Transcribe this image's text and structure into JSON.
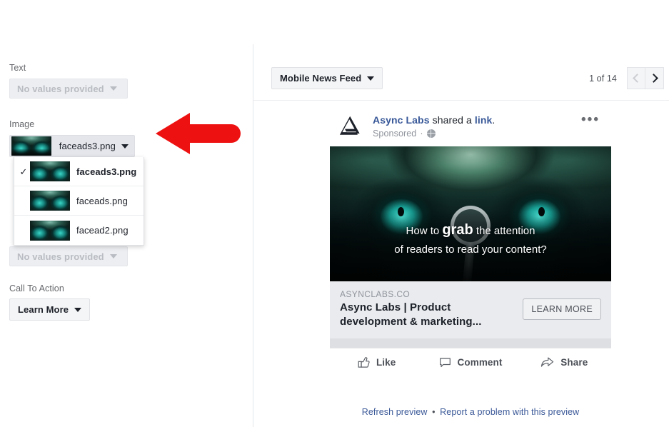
{
  "left_panel": {
    "text_field": {
      "label": "Text",
      "value": "No values provided"
    },
    "image_field": {
      "label": "Image",
      "selected_value": "faceads3.png",
      "options": [
        {
          "name": "faceads3.png",
          "checked": true
        },
        {
          "name": "faceads.png",
          "checked": false
        },
        {
          "name": "facead2.png",
          "checked": false
        }
      ]
    },
    "hidden_field": {
      "value": "No values provided"
    },
    "cta_field": {
      "label": "Call To Action",
      "value": "Learn More"
    },
    "annotation": {
      "shape": "left-pointing-arrow",
      "color": "#ee1111"
    }
  },
  "preview": {
    "toolbar": {
      "placement_label": "Mobile News Feed",
      "pager_count": "1 of 14",
      "prev_label": "Previous preview",
      "next_label": "Next preview",
      "prev_disabled": true
    },
    "ad": {
      "page_name": "Async Labs",
      "shared_text": "shared a",
      "link_word": "link",
      "period": ".",
      "sponsored": "Sponsored",
      "separator": "·",
      "privacy_icon": "globe-icon",
      "menu_icon": "ellipsis-icon",
      "creative": {
        "line1_prefix": "How to ",
        "line1_bold": "grab",
        "line1_suffix": " the attention",
        "line2": "of readers to read your content?",
        "alt": "Teal eyes formed from forest imagery with a magnifying glass"
      },
      "link_card": {
        "domain": "ASYNCLABS.CO",
        "title": "Async Labs | Product development & marketing...",
        "cta_button": "LEARN MORE"
      },
      "actions": [
        {
          "icon": "thumbs-up-icon",
          "label": "Like"
        },
        {
          "icon": "comment-bubble-icon",
          "label": "Comment"
        },
        {
          "icon": "share-arrow-icon",
          "label": "Share"
        }
      ]
    },
    "footer_links": {
      "refresh": "Refresh preview",
      "separator": "•",
      "report": "Report a problem with this preview"
    }
  },
  "colors": {
    "link_blue": "#385898",
    "annotation_red": "#ee1111",
    "card_meta_bg": "#e9ebee",
    "muted_text": "#90949c"
  }
}
